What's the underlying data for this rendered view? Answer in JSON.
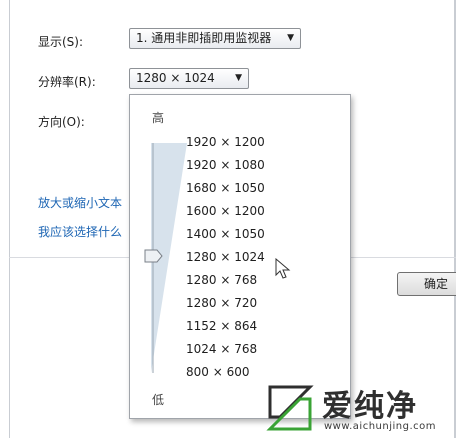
{
  "settings": {
    "display_label": "显示(S):",
    "display_value": "1. 通用非即插即用监视器",
    "resolution_label": "分辨率(R):",
    "resolution_value": "1280 × 1024",
    "orientation_label": "方向(O):",
    "link_enlarge": "放大或缩小文本",
    "link_choose": "我应该选择什么",
    "ok_button": "确定"
  },
  "resolution_dropdown": {
    "high_label": "高",
    "low_label": "低",
    "selected_index": 5,
    "options": [
      "1920 × 1200",
      "1920 × 1080",
      "1680 × 1050",
      "1600 × 1200",
      "1400 × 1050",
      "1280 × 1024",
      "1280 × 768",
      "1280 × 720",
      "1152 × 864",
      "1024 × 768",
      "800 × 600"
    ]
  },
  "watermark": {
    "brand": "爱纯净",
    "url": "www.aichunjing.com"
  },
  "colors": {
    "link": "#1e66b4",
    "track_fill": "#d7e2ec",
    "text": "#1e1e1e"
  }
}
